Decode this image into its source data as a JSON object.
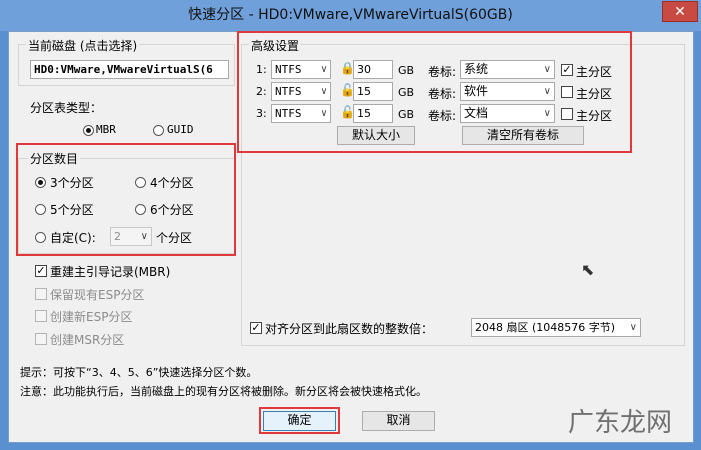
{
  "window": {
    "title": "快速分区 - HD0:VMware,VMwareVirtualS(60GB)",
    "close": "✕"
  },
  "disk": {
    "group_label": "当前磁盘 (点击选择)",
    "value": "HD0:VMware,VMwareVirtualS(6"
  },
  "table_type": {
    "label": "分区表类型：",
    "mbr": "MBR",
    "guid": "GUID",
    "selected": "MBR"
  },
  "count": {
    "label": "分区数目",
    "opt3": "3个分区",
    "opt4": "4个分区",
    "opt5": "5个分区",
    "opt6": "6个分区",
    "custom": "自定(C):",
    "custom_value": "2",
    "custom_suffix": "个分区",
    "selected": "3个分区"
  },
  "options": {
    "rebuild_mbr": "重建主引导记录(MBR)",
    "keep_esp": "保留现有ESP分区",
    "create_esp": "创建新ESP分区",
    "create_msr": "创建MSR分区"
  },
  "advanced": {
    "label": "高级设置",
    "gb": "GB",
    "vol_label": "卷标:",
    "primary": "主分区",
    "rows": [
      {
        "num": "1:",
        "fs": "NTFS",
        "size": "30",
        "volume": "系统",
        "primary": true
      },
      {
        "num": "2:",
        "fs": "NTFS",
        "size": "15",
        "volume": "软件",
        "primary": false
      },
      {
        "num": "3:",
        "fs": "NTFS",
        "size": "15",
        "volume": "文档",
        "primary": false
      }
    ],
    "default_size": "默认大小",
    "clear_labels": "清空所有卷标"
  },
  "align": {
    "label": "对齐分区到此扇区数的整数倍：",
    "value": "2048 扇区 (1048576 字节)"
  },
  "tips": {
    "tip": "提示：可按下“3、4、5、6”快速选择分区个数。",
    "note": "注意：此功能执行后，当前磁盘上的现有分区将被删除。新分区将会被快速格式化。"
  },
  "buttons": {
    "ok": "确定",
    "cancel": "取消"
  },
  "watermark": "广东龙网"
}
